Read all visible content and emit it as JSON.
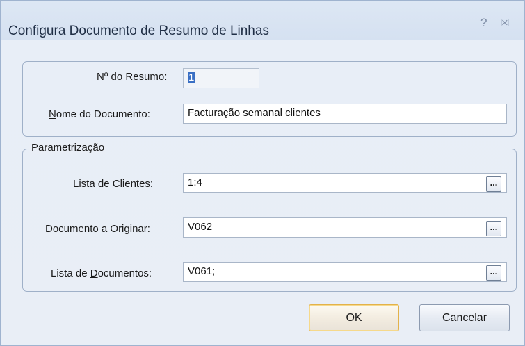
{
  "window": {
    "title": "Configura Documento de Resumo de Linhas",
    "help_glyph": "?",
    "close_glyph": "☒"
  },
  "top_group": {
    "resumo_label_pre": "Nº do ",
    "resumo_label_accel": "R",
    "resumo_label_post": "esumo:",
    "resumo_value": "1",
    "nome_label_accel": "N",
    "nome_label_post": "ome do Documento:",
    "nome_value": "Facturação semanal clientes"
  },
  "param_group": {
    "legend": "Parametrização",
    "clientes_label_pre": "Lista de ",
    "clientes_label_accel": "C",
    "clientes_label_post": "lientes:",
    "clientes_value": "1:4",
    "documento_label_pre": "Documento a ",
    "documento_label_accel": "O",
    "documento_label_post": "riginar:",
    "documento_value": "V062",
    "lista_docs_label_pre": "Lista de ",
    "lista_docs_label_accel": "D",
    "lista_docs_label_post": "ocumentos:",
    "lista_docs_value": "V061;",
    "ellipsis_label": "..."
  },
  "buttons": {
    "ok_label": "OK",
    "cancel_label": "Cancelar"
  }
}
